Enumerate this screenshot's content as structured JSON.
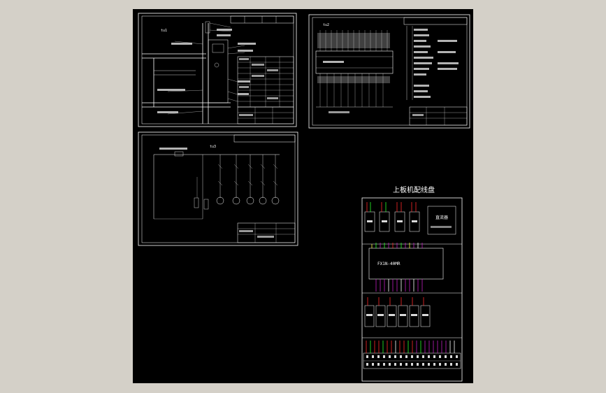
{
  "colors": {
    "background": "#d4d0c8",
    "canvas": "#000000",
    "line": "#ffffff",
    "accent_red": "#ff2a2a",
    "accent_green": "#2aff2a",
    "accent_magenta": "#c020c0",
    "accent_yellow": "#ffff40"
  },
  "panel_layout": {
    "title": "上板机配线盘",
    "plc_label": "FX1N-40MR",
    "power_box_label": "直流器"
  },
  "sheets": {
    "sheet1_label": "tu1",
    "sheet2_label": "tu2",
    "sheet3_label": "tu3"
  }
}
